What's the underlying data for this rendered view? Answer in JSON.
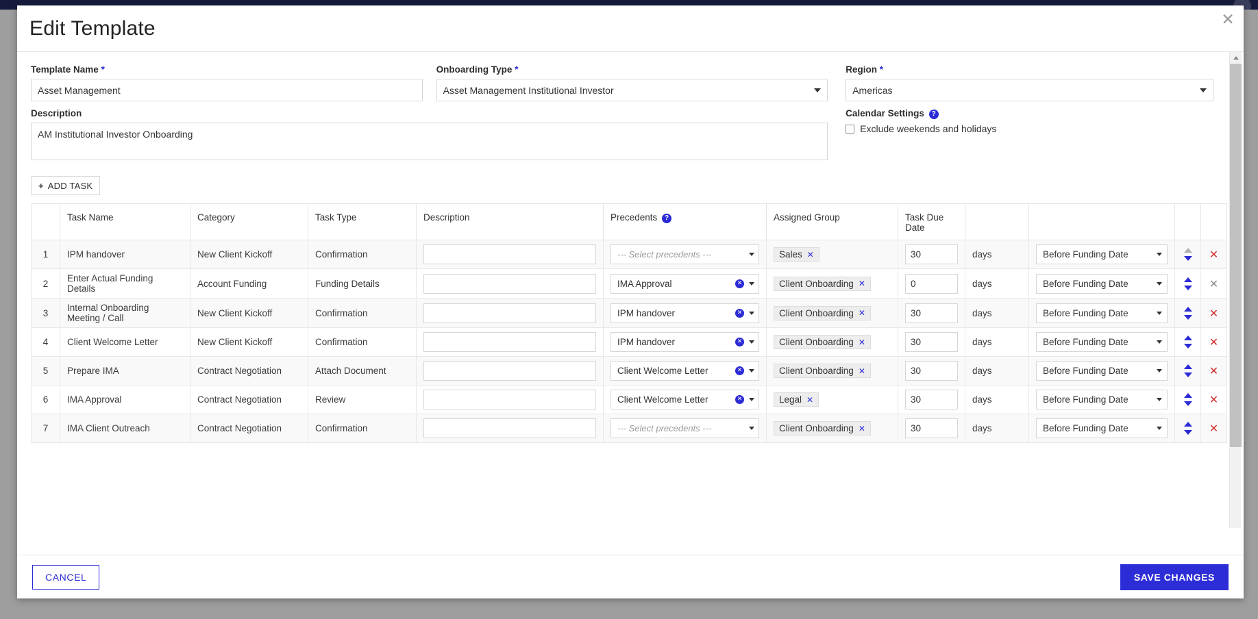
{
  "modal": {
    "title": "Edit Template",
    "close_icon": "close-icon"
  },
  "form": {
    "template_name": {
      "label": "Template Name",
      "required_mark": "*",
      "value": "Asset Management"
    },
    "onboarding_type": {
      "label": "Onboarding Type",
      "required_mark": "*",
      "value": "Asset Management Institutional Investor"
    },
    "region": {
      "label": "Region",
      "required_mark": "*",
      "value": "Americas"
    },
    "description": {
      "label": "Description",
      "value": "AM Institutional Investor Onboarding"
    },
    "calendar_settings": {
      "label": "Calendar Settings",
      "help_icon": "help-icon",
      "exclude_label": "Exclude weekends and holidays",
      "exclude_checked": false
    }
  },
  "toolbar": {
    "add_task_label": "ADD TASK",
    "add_task_plus": "+"
  },
  "table": {
    "headers": {
      "index": "",
      "task_name": "Task Name",
      "category": "Category",
      "task_type": "Task Type",
      "description": "Description",
      "precedents": "Precedents",
      "precedents_help_icon": "help-icon",
      "assigned_group": "Assigned Group",
      "task_due_date": "Task Due Date",
      "days_unit": "",
      "relative": "",
      "reorder": "",
      "delete": ""
    },
    "precedents_placeholder": "--- Select precedents ---",
    "days_unit": "days",
    "rows": [
      {
        "index": "1",
        "task_name": "IPM handover",
        "category": "New Client Kickoff",
        "task_type": "Confirmation",
        "description": "",
        "precedent": "",
        "precedent_placeholder": "--- Select precedents ---",
        "assigned_group": "Sales",
        "due_days": "30",
        "days_unit": "days",
        "relative_to": "Before Funding Date",
        "up_enabled": false,
        "down_enabled": true,
        "delete_enabled": true
      },
      {
        "index": "2",
        "task_name": "Enter Actual Funding Details",
        "category": "Account Funding",
        "task_type": "Funding Details",
        "description": "",
        "precedent": "IMA Approval",
        "assigned_group": "Client Onboarding",
        "due_days": "0",
        "days_unit": "days",
        "relative_to": "Before Funding Date",
        "up_enabled": true,
        "down_enabled": true,
        "delete_enabled": false
      },
      {
        "index": "3",
        "task_name": "Internal Onboarding Meeting / Call",
        "category": "New Client Kickoff",
        "task_type": "Confirmation",
        "description": "",
        "precedent": "IPM handover",
        "assigned_group": "Client Onboarding",
        "due_days": "30",
        "days_unit": "days",
        "relative_to": "Before Funding Date",
        "up_enabled": true,
        "down_enabled": true,
        "delete_enabled": true
      },
      {
        "index": "4",
        "task_name": "Client Welcome Letter",
        "category": "New Client Kickoff",
        "task_type": "Confirmation",
        "description": "",
        "precedent": "IPM handover",
        "assigned_group": "Client Onboarding",
        "due_days": "30",
        "days_unit": "days",
        "relative_to": "Before Funding Date",
        "up_enabled": true,
        "down_enabled": true,
        "delete_enabled": true
      },
      {
        "index": "5",
        "task_name": "Prepare IMA",
        "category": "Contract Negotiation",
        "task_type": "Attach Document",
        "description": "",
        "precedent": "Client Welcome Letter",
        "assigned_group": "Client Onboarding",
        "due_days": "30",
        "days_unit": "days",
        "relative_to": "Before Funding Date",
        "up_enabled": true,
        "down_enabled": true,
        "delete_enabled": true
      },
      {
        "index": "6",
        "task_name": "IMA Approval",
        "category": "Contract Negotiation",
        "task_type": "Review",
        "description": "",
        "precedent": "Client Welcome Letter",
        "assigned_group": "Legal",
        "due_days": "30",
        "days_unit": "days",
        "relative_to": "Before Funding Date",
        "up_enabled": true,
        "down_enabled": true,
        "delete_enabled": true
      },
      {
        "index": "7",
        "task_name": "IMA Client Outreach",
        "category": "Contract Negotiation",
        "task_type": "Confirmation",
        "description": "",
        "precedent": "",
        "precedent_placeholder": "--- Select precedents ---",
        "assigned_group": "Client Onboarding",
        "due_days": "30",
        "days_unit": "days",
        "relative_to": "Before Funding Date",
        "up_enabled": true,
        "down_enabled": true,
        "delete_enabled": true
      }
    ]
  },
  "footer": {
    "cancel_label": "CANCEL",
    "save_label": "SAVE CHANGES"
  },
  "colors": {
    "accent": "#2b2bd6",
    "save_button": "#2d2dd8",
    "delete": "#d32f2f",
    "disabled": "#8d8d8d",
    "backdrop": "#9e9e9e",
    "appbar": "#161b3d"
  }
}
